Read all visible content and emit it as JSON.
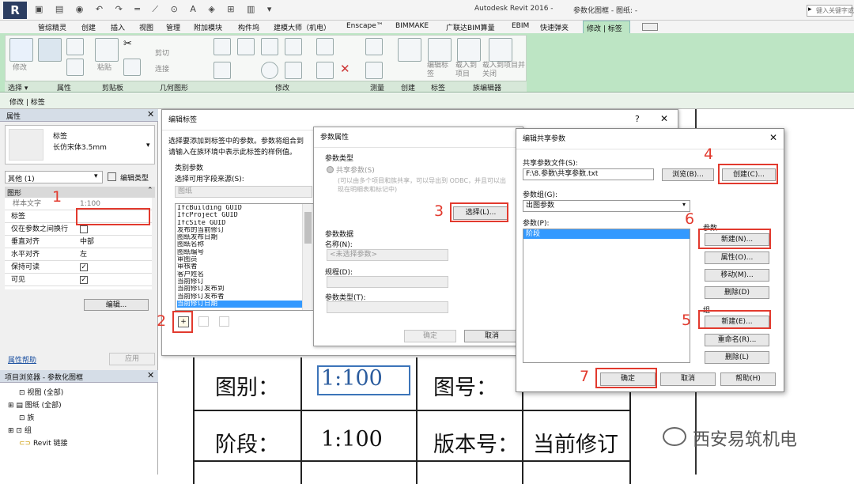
{
  "app": {
    "window_title": "Autodesk Revit 2016 -",
    "doc_title": "参数化图框 - 图纸: -",
    "search_placeholder": "键入关键字或短语"
  },
  "ribbon": {
    "tabs": [
      "管综精灵",
      "创建",
      "插入",
      "视图",
      "管理",
      "附加模块",
      "构件坞",
      "建模大师（机电）",
      "Enscape™",
      "BIMMAKE",
      "广联达BIM算量",
      "EBIM",
      "快速弹夹",
      "修改 | 标签"
    ],
    "active_tab": "修改 | 标签",
    "panels": [
      "选择 ▾",
      "属性",
      "剪贴板",
      "几何图形",
      "修改",
      "测量",
      "创建",
      "标签",
      "族编辑器"
    ],
    "buttons": {
      "modify": "修改",
      "paste": "粘贴",
      "cut": "剪切",
      "join": "连接",
      "edit_label": "编辑标签",
      "load_project": "载入到项目",
      "load_close": "载入到项目并关闭"
    },
    "context_bar": "修改 | 标签"
  },
  "properties": {
    "title": "属性",
    "type_name": "标签",
    "type_sub": "长仿宋体3.5mm",
    "filter": "其他 (1)",
    "edit_type": "编辑类型",
    "group": "图形",
    "rows": [
      {
        "name": "样本文字",
        "value": "1:100"
      },
      {
        "name": "标签",
        "value": "编辑..."
      },
      {
        "name": "仅在参数之间换行",
        "value": ""
      },
      {
        "name": "垂直对齐",
        "value": "中部"
      },
      {
        "name": "水平对齐",
        "value": "左"
      },
      {
        "name": "保持可读",
        "value": ""
      },
      {
        "name": "可见",
        "value": ""
      }
    ],
    "help_link": "属性帮助",
    "apply": "应用"
  },
  "browser": {
    "title": "项目浏览器 - 参数化图框",
    "items": [
      "视图 (全部)",
      "图纸 (全部)",
      "族",
      "组",
      "Revit 链接"
    ]
  },
  "edit_label": {
    "title": "编辑标签",
    "help": "?",
    "desc1": "选择要添加到标签中的参数。参数将组合到",
    "desc2": "请输入在族环境中表示此标签的样例值。",
    "category_label": "类别参数",
    "source_label": "选择可用字段来源(S):",
    "source_value": "图纸",
    "params": [
      "IfcBuilding GUID",
      "IfcProject GUID",
      "IfcSite GUID",
      "发布的当前修订",
      "图纸发布日期",
      "图纸名称",
      "图纸编号",
      "审图员",
      "审核者",
      "客户姓名",
      "当前修订",
      "当前修订发布到",
      "当前修订发布者",
      "当前修订日期"
    ]
  },
  "param_props": {
    "title": "参数属性",
    "type_group": "参数类型",
    "shared": "共享参数(S)",
    "shared_desc": "(可以由多个项目和族共享，可以导出到 ODBC，并且可以出现在明细表和标记中)",
    "select": "选择(L)...",
    "data_group": "参数数据",
    "name_label": "名称(N):",
    "name_value": "<未选择参数>",
    "discipline": "规程(D):",
    "param_type": "参数类型(T):",
    "ok": "确定",
    "cancel": "取消"
  },
  "shared_params": {
    "title": "编辑共享参数",
    "close": "✕",
    "file_label": "共享参数文件(S):",
    "file_value": "F:\\8.参数\\共享参数.txt",
    "browse": "浏览(B)...",
    "create": "创建(C)...",
    "group_label": "参数组(G):",
    "group_value": "出图参数",
    "params_label": "参数(P):",
    "params": [
      "阶段"
    ],
    "param_section": "参数",
    "new_param": "新建(N)...",
    "properties": "属性(O)...",
    "move": "移动(M)...",
    "delete_param": "删除(D)",
    "group_section": "组",
    "new_group": "新建(E)...",
    "rename": "重命名(R)...",
    "delete_group": "删除(L)",
    "ok": "确定",
    "cancel": "取消",
    "help": "帮助(H)"
  },
  "steps": [
    "1",
    "2",
    "3",
    "4",
    "5",
    "6",
    "7"
  ],
  "titleblock": {
    "r1": [
      "图别：",
      "1:100",
      "图号："
    ],
    "r2": [
      "阶段：",
      "1:100",
      "版本号：",
      "当前修订"
    ]
  },
  "watermark": "西安易筑机电",
  "colors": {
    "accent": "#e23a2e",
    "ribbon_green": "#bde5c4",
    "selection": "#3399ff"
  }
}
